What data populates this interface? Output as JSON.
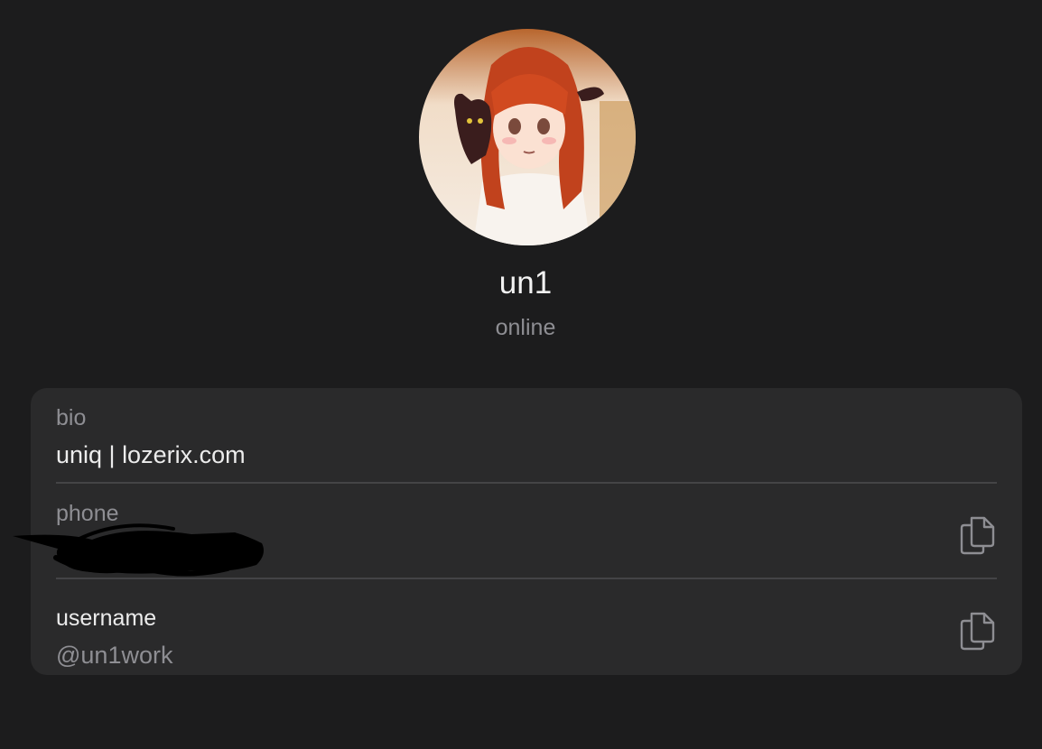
{
  "profile": {
    "name": "un1",
    "status": "online",
    "avatar_icon": "avatar-icon"
  },
  "info": {
    "bio": {
      "label": "bio",
      "value": "uniq | lozerix.com"
    },
    "phone": {
      "label": "phone",
      "copy_icon": "copy-icon"
    },
    "username": {
      "label": "username",
      "value": "@un1work",
      "copy_icon": "copy-icon"
    }
  },
  "colors": {
    "background": "#1c1c1d",
    "card": "#2a2a2b",
    "text_primary": "#ececec",
    "text_secondary": "#8e8e93",
    "divider": "#444446"
  }
}
